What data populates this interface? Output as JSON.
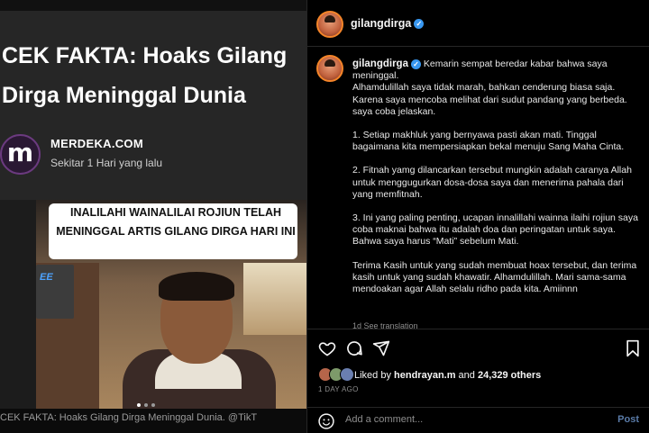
{
  "article": {
    "headline": "CEK FAKTA: Hoaks Gilang Dirga Meninggal Dunia",
    "publisher": "MERDEKA.COM",
    "publisher_logo_letter": "m",
    "time": "Sekitar 1 Hari yang lalu",
    "image_overlay_text": "INALILAHI WAINALILAI ROJIUN TELAH MENINGGAL ARTIS GILANG DIRGA HARI INI",
    "ac_logo": "EE",
    "image_caption": "CEK FAKTA: Hoaks Gilang Dirga Meninggal Dunia. @TikT"
  },
  "instagram": {
    "header_username": "gilangdirga",
    "caption_username": "gilangdirga",
    "caption_paragraphs": [
      "Kemarin sempat beredar kabar bahwa saya meninggal.\nAlhamdulillah saya tidak marah, bahkan cenderung biasa saja. Karena saya mencoba melihat dari sudut pandang yang berbeda. saya coba jelaskan.",
      "1. Setiap makhluk yang bernyawa pasti akan mati. Tinggal bagaimana kita mempersiapkan bekal menuju Sang Maha Cinta.",
      "2. Fitnah yamg dilancarkan tersebut mungkin adalah caranya Allah untuk menggugurkan dosa-dosa saya dan menerima pahala dari yang memfitnah.",
      "3. Ini yang paling penting, ucapan innalillahi wainna ilaihi rojiun saya coba maknai bahwa itu adalah doa dan peringatan untuk saya. Bahwa saya harus “Mati” sebelum Mati.",
      "Terima Kasih untuk yang sudah membuat hoax tersebut, dan terima kasih untuk yang sudah khawatir. Alhamdulillah. Mari sama-sama mendoakan agar Allah selalu ridho pada kita. Amiinnn"
    ],
    "caption_meta": "1d   See translation",
    "liked_by_prefix": "Liked by ",
    "liked_by_user": "hendrayan.m",
    "liked_by_and": " and ",
    "liked_by_count": "24,329 others",
    "date": "1 DAY AGO",
    "comment_placeholder": "Add a comment...",
    "post_label": "Post"
  },
  "icons": {
    "heart": "heart-icon",
    "comment": "comment-icon",
    "share": "share-icon",
    "bookmark": "bookmark-icon",
    "emoji": "emoji-icon",
    "verified": "verified-badge-icon"
  },
  "colors": {
    "background": "#000000",
    "verified": "#3897f0",
    "post_button": "#5a7ba8",
    "article_card": "#262626"
  }
}
